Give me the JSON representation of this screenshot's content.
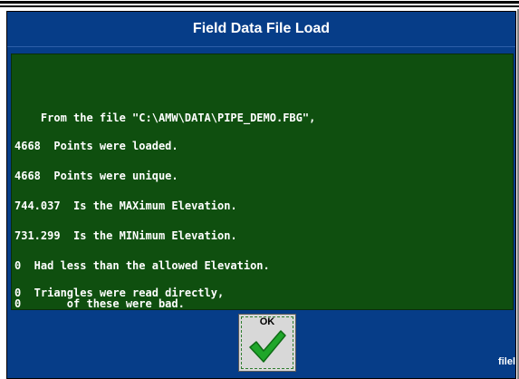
{
  "dialog": {
    "title": "Field Data File Load",
    "report_lines": [
      "    From the file \"C:\\AMW\\DATA\\PIPE_DEMO.FBG\",",
      "4668  Points were loaded.",
      "4668  Points were unique.",
      "744.037  Is the MAXimum Elevation.",
      "731.299  Is the MINimum Elevation.",
      "0  Had less than the allowed Elevation.",
      "0  Triangles were read directly,",
      "0       of these were bad."
    ],
    "ok_label": "OK",
    "corner_text": "filel"
  },
  "colors": {
    "dialog_bg": "#063d88",
    "report_bg": "#0f4f0f",
    "check": "#1fa62a"
  },
  "icons": {
    "ok": "checkmark-icon"
  }
}
